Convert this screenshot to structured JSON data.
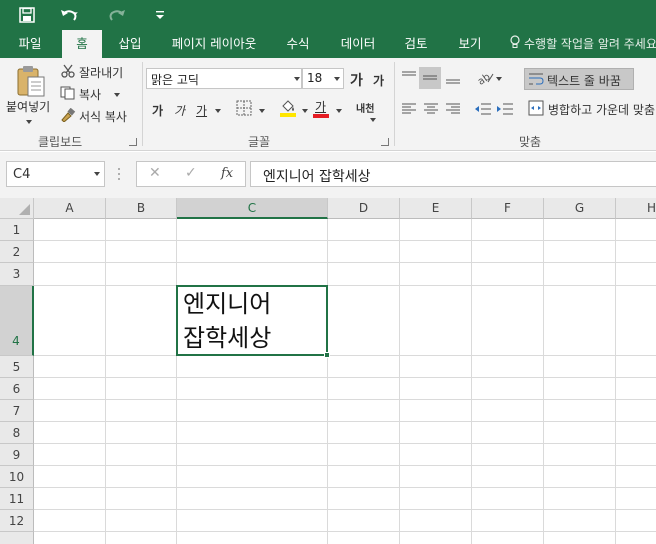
{
  "quick_access": {
    "save_icon": "save-icon",
    "undo_icon": "undo-icon",
    "redo_icon": "redo-icon",
    "customize_icon": "customize-qat-icon"
  },
  "tabs": [
    {
      "label": "파일"
    },
    {
      "label": "홈",
      "active": true
    },
    {
      "label": "삽입"
    },
    {
      "label": "페이지 레이아웃"
    },
    {
      "label": "수식"
    },
    {
      "label": "데이터"
    },
    {
      "label": "검토"
    },
    {
      "label": "보기"
    }
  ],
  "tell_me": "수행할 작업을 알려 주세요",
  "clipboard": {
    "paste_label": "붙여넣기",
    "cut_label": "잘라내기",
    "copy_label": "복사",
    "format_painter_label": "서식 복사",
    "group_label": "클립보드"
  },
  "font": {
    "font_name": "맑은 고딕",
    "font_size": "18",
    "bold": "가",
    "italic": "가",
    "underline": "가",
    "increase_label": "가",
    "decrease_label": "가",
    "font_color_label": "가",
    "phonetic_label": "내천",
    "group_label": "글꼴"
  },
  "alignment": {
    "wrap_text_label": "텍스트 줄 바꿈",
    "merge_center_label": "병합하고 가운데 맞춤",
    "group_label": "맞춤"
  },
  "formula_bar": {
    "name_box": "C4",
    "cancel_symbol": "✕",
    "enter_symbol": "✓",
    "fx_label": "fx",
    "formula": "엔지니어 잡학세상"
  },
  "sheet": {
    "columns": [
      "A",
      "B",
      "C",
      "D",
      "E",
      "F",
      "G",
      "H"
    ],
    "rows": [
      "1",
      "2",
      "3",
      "4",
      "5",
      "6",
      "7",
      "8",
      "9",
      "10",
      "11",
      "12"
    ],
    "active_cell": "C4",
    "active_cell_value": "엔지니어 잡학세상"
  },
  "colors": {
    "accent": "#217346",
    "ribbon_bg": "#f3f3f3",
    "grid_line": "#dadada"
  }
}
